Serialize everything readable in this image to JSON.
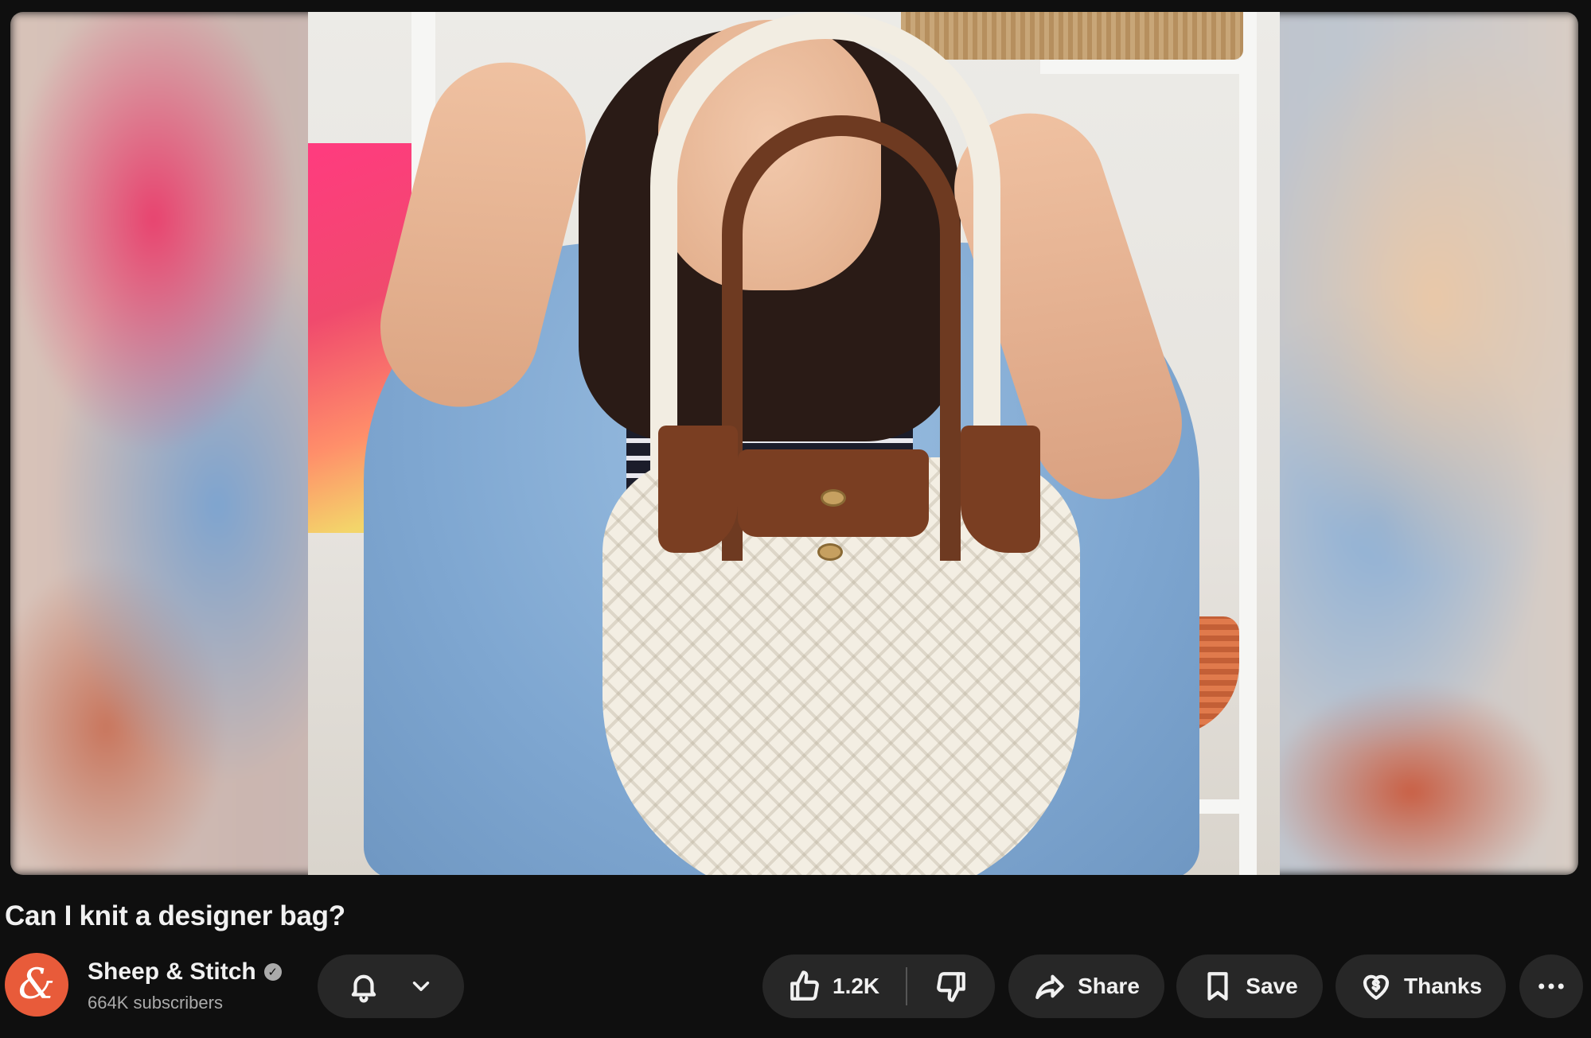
{
  "video": {
    "title": "Can I knit a designer bag?"
  },
  "channel": {
    "avatar_glyph": "&",
    "name": "Sheep & Stitch",
    "verified_icon": "check-circle-icon",
    "subscribers": "664K subscribers"
  },
  "actions": {
    "like_count": "1.2K",
    "share_label": "Share",
    "save_label": "Save",
    "thanks_label": "Thanks",
    "more_glyph": "•••"
  },
  "colors": {
    "background": "#0f0f0f",
    "pill": "#272727",
    "text_primary": "#f1f1f1",
    "text_secondary": "#aaaaaa",
    "avatar": "#e85b3a"
  }
}
